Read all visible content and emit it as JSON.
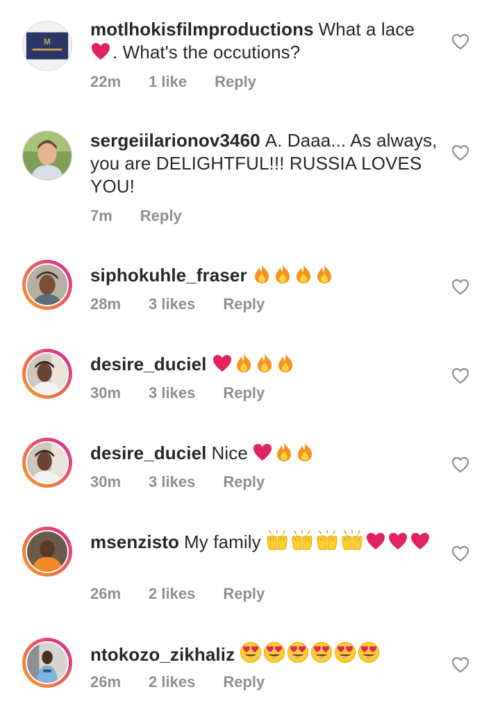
{
  "colors": {
    "text": "#262626",
    "meta": "#8e8e8e",
    "heart_emoji": "#e0245e",
    "story_ring_start": "#f9a01b",
    "story_ring_end": "#d6249f"
  },
  "comments": [
    {
      "username": "motlhokisfilmproductions",
      "text_1": "What a lace",
      "text_2": ". What's the occutions?",
      "time": "22m",
      "likes": "1 like",
      "reply": "Reply",
      "avatar": "logo-avatar",
      "emoji_1": [
        "heart-emoji"
      ]
    },
    {
      "username": "sergeiilarionov3460",
      "text_1": "A. Daaa... As always, you are DELIGHTFUL!!! RUSSIA LOVES YOU!",
      "time": "7m",
      "reply": "Reply",
      "avatar": "profile-photo"
    },
    {
      "username": "siphokuhle_fraser",
      "time": "28m",
      "likes": "3 likes",
      "reply": "Reply",
      "avatar": "story-profile-photo",
      "emoji_1": [
        "fire-emoji",
        "fire-emoji",
        "fire-emoji",
        "fire-emoji"
      ]
    },
    {
      "username": "desire_duciel",
      "time": "30m",
      "likes": "3 likes",
      "reply": "Reply",
      "avatar": "story-profile-photo",
      "emoji_1": [
        "heart-emoji",
        "fire-emoji",
        "fire-emoji",
        "fire-emoji"
      ]
    },
    {
      "username": "desire_duciel",
      "text_1": "Nice",
      "time": "30m",
      "likes": "3 likes",
      "reply": "Reply",
      "avatar": "story-profile-photo",
      "emoji_1": [
        "heart-emoji",
        "fire-emoji",
        "fire-emoji"
      ]
    },
    {
      "username": "msenzisto",
      "text_1": "My family",
      "time": "26m",
      "likes": "2 likes",
      "reply": "Reply",
      "avatar": "story-profile-photo",
      "emoji_1": [
        "raised-hands-emoji",
        "raised-hands-emoji",
        "raised-hands-emoji",
        "raised-hands-emoji",
        "heart-emoji",
        "heart-emoji",
        "heart-emoji"
      ]
    },
    {
      "username": "ntokozo_zikhaliz",
      "time": "26m",
      "likes": "2 likes",
      "reply": "Reply",
      "avatar": "story-profile-photo",
      "emoji_1": [
        "heart-eyes-emoji",
        "heart-eyes-emoji",
        "heart-eyes-emoji",
        "heart-eyes-emoji",
        "heart-eyes-emoji",
        "heart-eyes-emoji"
      ]
    }
  ]
}
